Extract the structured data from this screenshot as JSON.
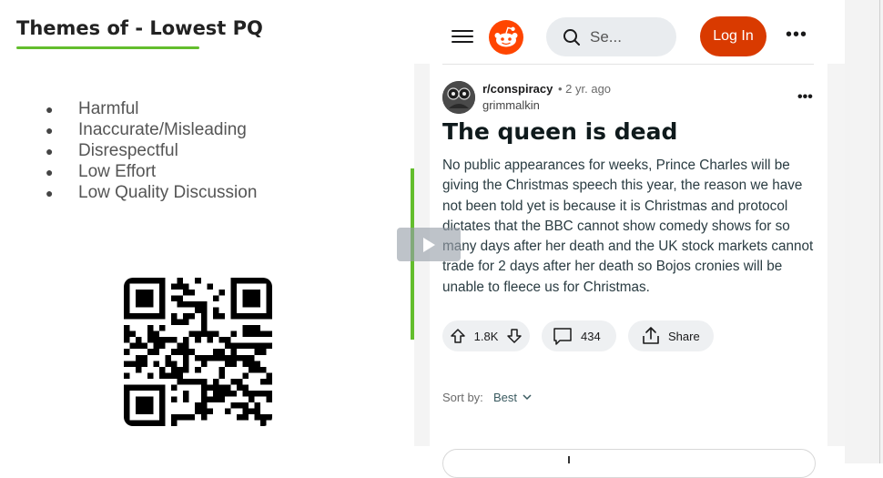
{
  "slide": {
    "title": "Themes of - Lowest PQ",
    "bullet_symbol": "●",
    "themes": [
      "Harmful",
      "Inaccurate/Misleading",
      "Disrespectful",
      "Low Effort",
      "Low Quality Discussion"
    ]
  },
  "header": {
    "search_placeholder": "Se...",
    "login_label": "Log In",
    "more_label": "•••"
  },
  "post": {
    "subreddit": "r/conspiracy",
    "age": "• 2 yr. ago",
    "author": "grimmalkin",
    "more_label": "•••",
    "title": "The queen is dead",
    "body": "No public appearances for weeks, Prince Charles will be giving the Christmas speech this year, the reason we have not been told yet is because it is Christmas and protocol dictates that the BBC cannot show comedy shows for so many days after her death and the UK stock markets cannot trade for 2 days after her death so Bojos cronies will be unable to fleece us for Christmas.",
    "votes": "1.8K",
    "comments": "434",
    "share_label": "Share"
  },
  "sort": {
    "label": "Sort by:",
    "value": "Best"
  },
  "colors": {
    "accent_green": "#63be2d",
    "reddit_orange": "#ff4500",
    "login_button": "#d93a00"
  },
  "icons": [
    "menu-icon",
    "reddit-logo-icon",
    "search-icon",
    "upvote-icon",
    "downvote-icon",
    "comment-icon",
    "share-icon",
    "chevron-down-icon",
    "play-icon",
    "qr-code"
  ]
}
